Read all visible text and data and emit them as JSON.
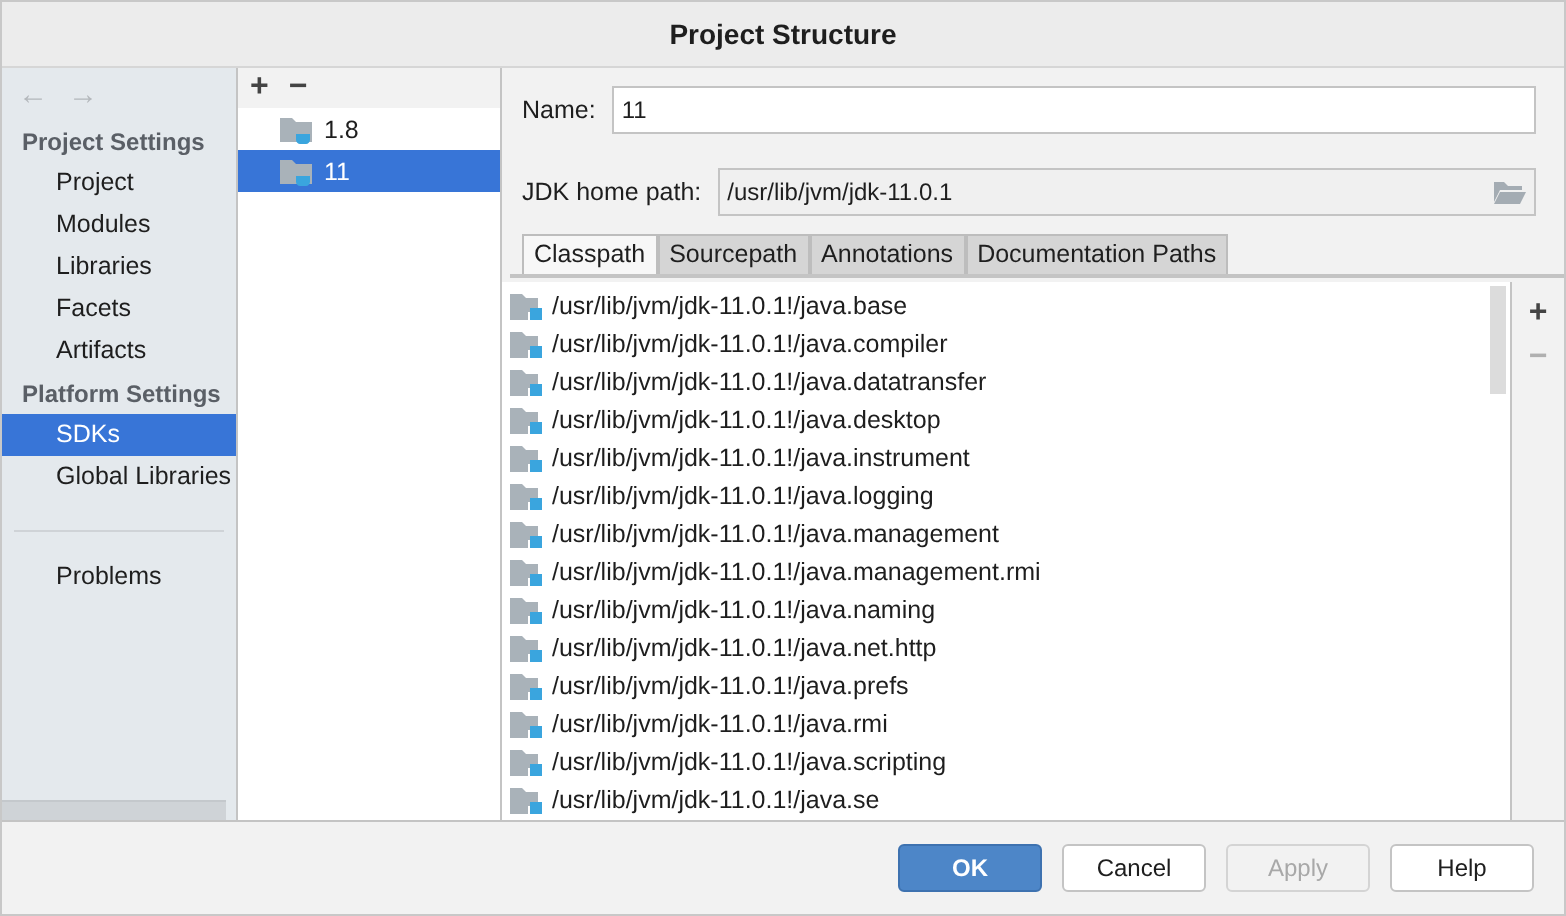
{
  "window": {
    "title": "Project Structure"
  },
  "nav": {
    "back": "←",
    "forward": "→"
  },
  "sidebar": {
    "sections": [
      {
        "title": "Project Settings",
        "items": [
          {
            "label": "Project",
            "selected": false
          },
          {
            "label": "Modules",
            "selected": false
          },
          {
            "label": "Libraries",
            "selected": false
          },
          {
            "label": "Facets",
            "selected": false
          },
          {
            "label": "Artifacts",
            "selected": false
          }
        ]
      },
      {
        "title": "Platform Settings",
        "items": [
          {
            "label": "SDKs",
            "selected": true
          },
          {
            "label": "Global Libraries",
            "selected": false
          }
        ]
      }
    ],
    "footer_items": [
      {
        "label": "Problems",
        "selected": false
      }
    ]
  },
  "sdk_toolbar": {
    "add": "+",
    "remove": "−"
  },
  "sdks": [
    {
      "label": "1.8",
      "selected": false
    },
    {
      "label": "11",
      "selected": true
    }
  ],
  "name_field": {
    "label": "Name:",
    "value": "11"
  },
  "home_path_field": {
    "label": "JDK home path:",
    "value": "/usr/lib/jvm/jdk-11.0.1"
  },
  "tabs": [
    {
      "label": "Classpath",
      "selected": true
    },
    {
      "label": "Sourcepath",
      "selected": false
    },
    {
      "label": "Annotations",
      "selected": false
    },
    {
      "label": "Documentation Paths",
      "selected": false
    }
  ],
  "classpath": [
    "/usr/lib/jvm/jdk-11.0.1!/java.base",
    "/usr/lib/jvm/jdk-11.0.1!/java.compiler",
    "/usr/lib/jvm/jdk-11.0.1!/java.datatransfer",
    "/usr/lib/jvm/jdk-11.0.1!/java.desktop",
    "/usr/lib/jvm/jdk-11.0.1!/java.instrument",
    "/usr/lib/jvm/jdk-11.0.1!/java.logging",
    "/usr/lib/jvm/jdk-11.0.1!/java.management",
    "/usr/lib/jvm/jdk-11.0.1!/java.management.rmi",
    "/usr/lib/jvm/jdk-11.0.1!/java.naming",
    "/usr/lib/jvm/jdk-11.0.1!/java.net.http",
    "/usr/lib/jvm/jdk-11.0.1!/java.prefs",
    "/usr/lib/jvm/jdk-11.0.1!/java.rmi",
    "/usr/lib/jvm/jdk-11.0.1!/java.scripting",
    "/usr/lib/jvm/jdk-11.0.1!/java.se"
  ],
  "list_toolbar": {
    "add": "+",
    "remove": "−",
    "remove_disabled": true
  },
  "buttons": [
    {
      "label": "OK",
      "kind": "primary",
      "disabled": false
    },
    {
      "label": "Cancel",
      "kind": "normal",
      "disabled": false
    },
    {
      "label": "Apply",
      "kind": "normal",
      "disabled": true
    },
    {
      "label": "Help",
      "kind": "normal",
      "disabled": false
    }
  ]
}
